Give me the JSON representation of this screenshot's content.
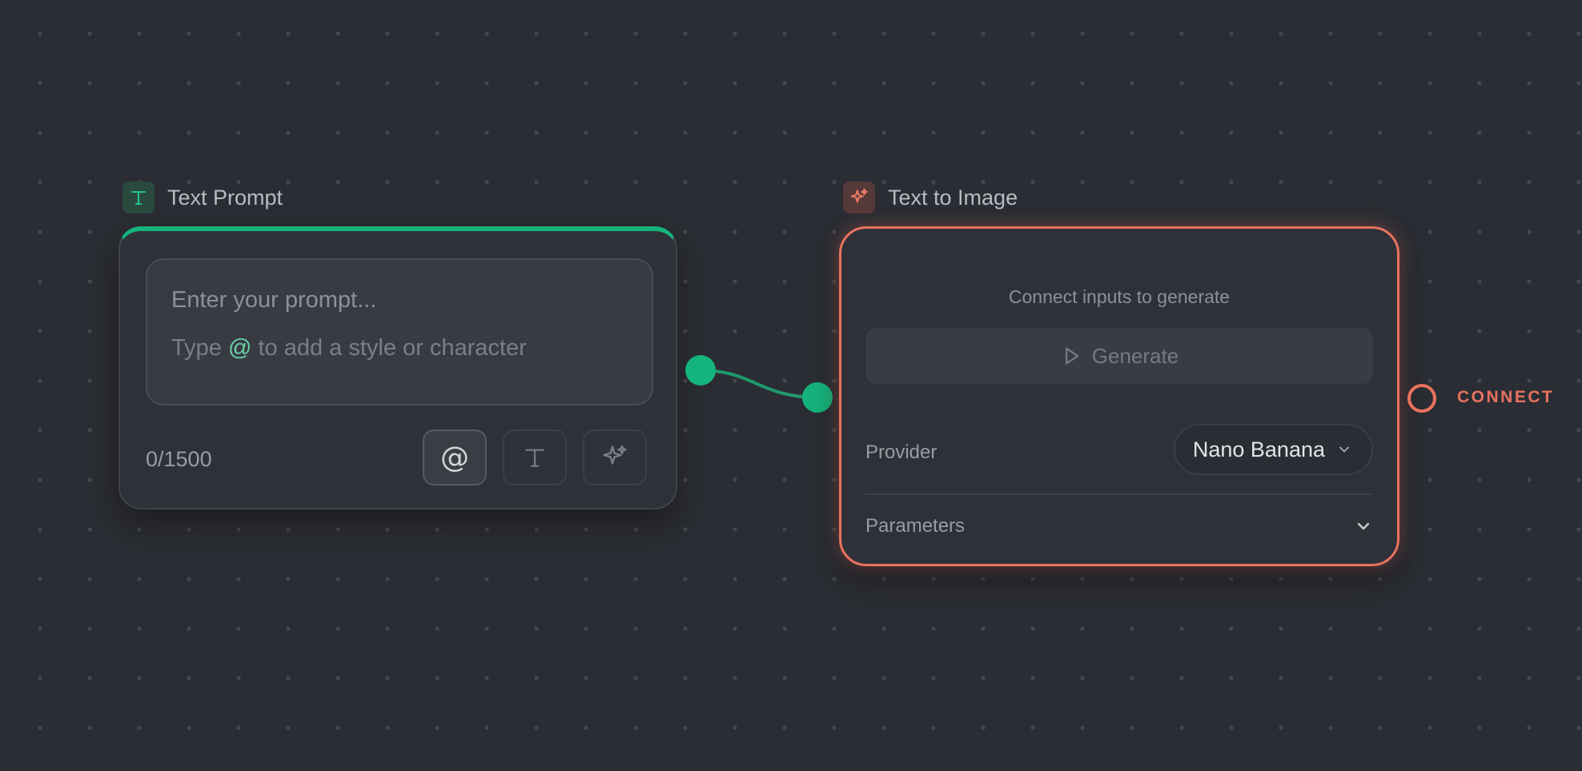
{
  "canvas": {
    "accent_green": "#15b47c",
    "accent_coral": "#e8735f",
    "background": "#2b2d34"
  },
  "text_prompt_node": {
    "title": "Text Prompt",
    "title_icon": "type-icon",
    "prompt_placeholder": "Enter your prompt...",
    "hint_before": "Type ",
    "hint_at": "@",
    "hint_after": " to add a style or character",
    "char_count": "0/1500",
    "tools": [
      {
        "name": "mention-button",
        "icon": "at-icon",
        "glyph": "@"
      },
      {
        "name": "text-style-button",
        "icon": "type-icon"
      },
      {
        "name": "enhance-button",
        "icon": "sparkles-icon"
      }
    ]
  },
  "text_to_image_node": {
    "title": "Text to Image",
    "title_icon": "sparkles-icon",
    "status_message": "Connect inputs to generate",
    "generate_label": "Generate",
    "provider_label": "Provider",
    "provider_value": "Nano Banana",
    "parameters_label": "Parameters"
  },
  "output_handle": {
    "label": "CONNECT"
  }
}
